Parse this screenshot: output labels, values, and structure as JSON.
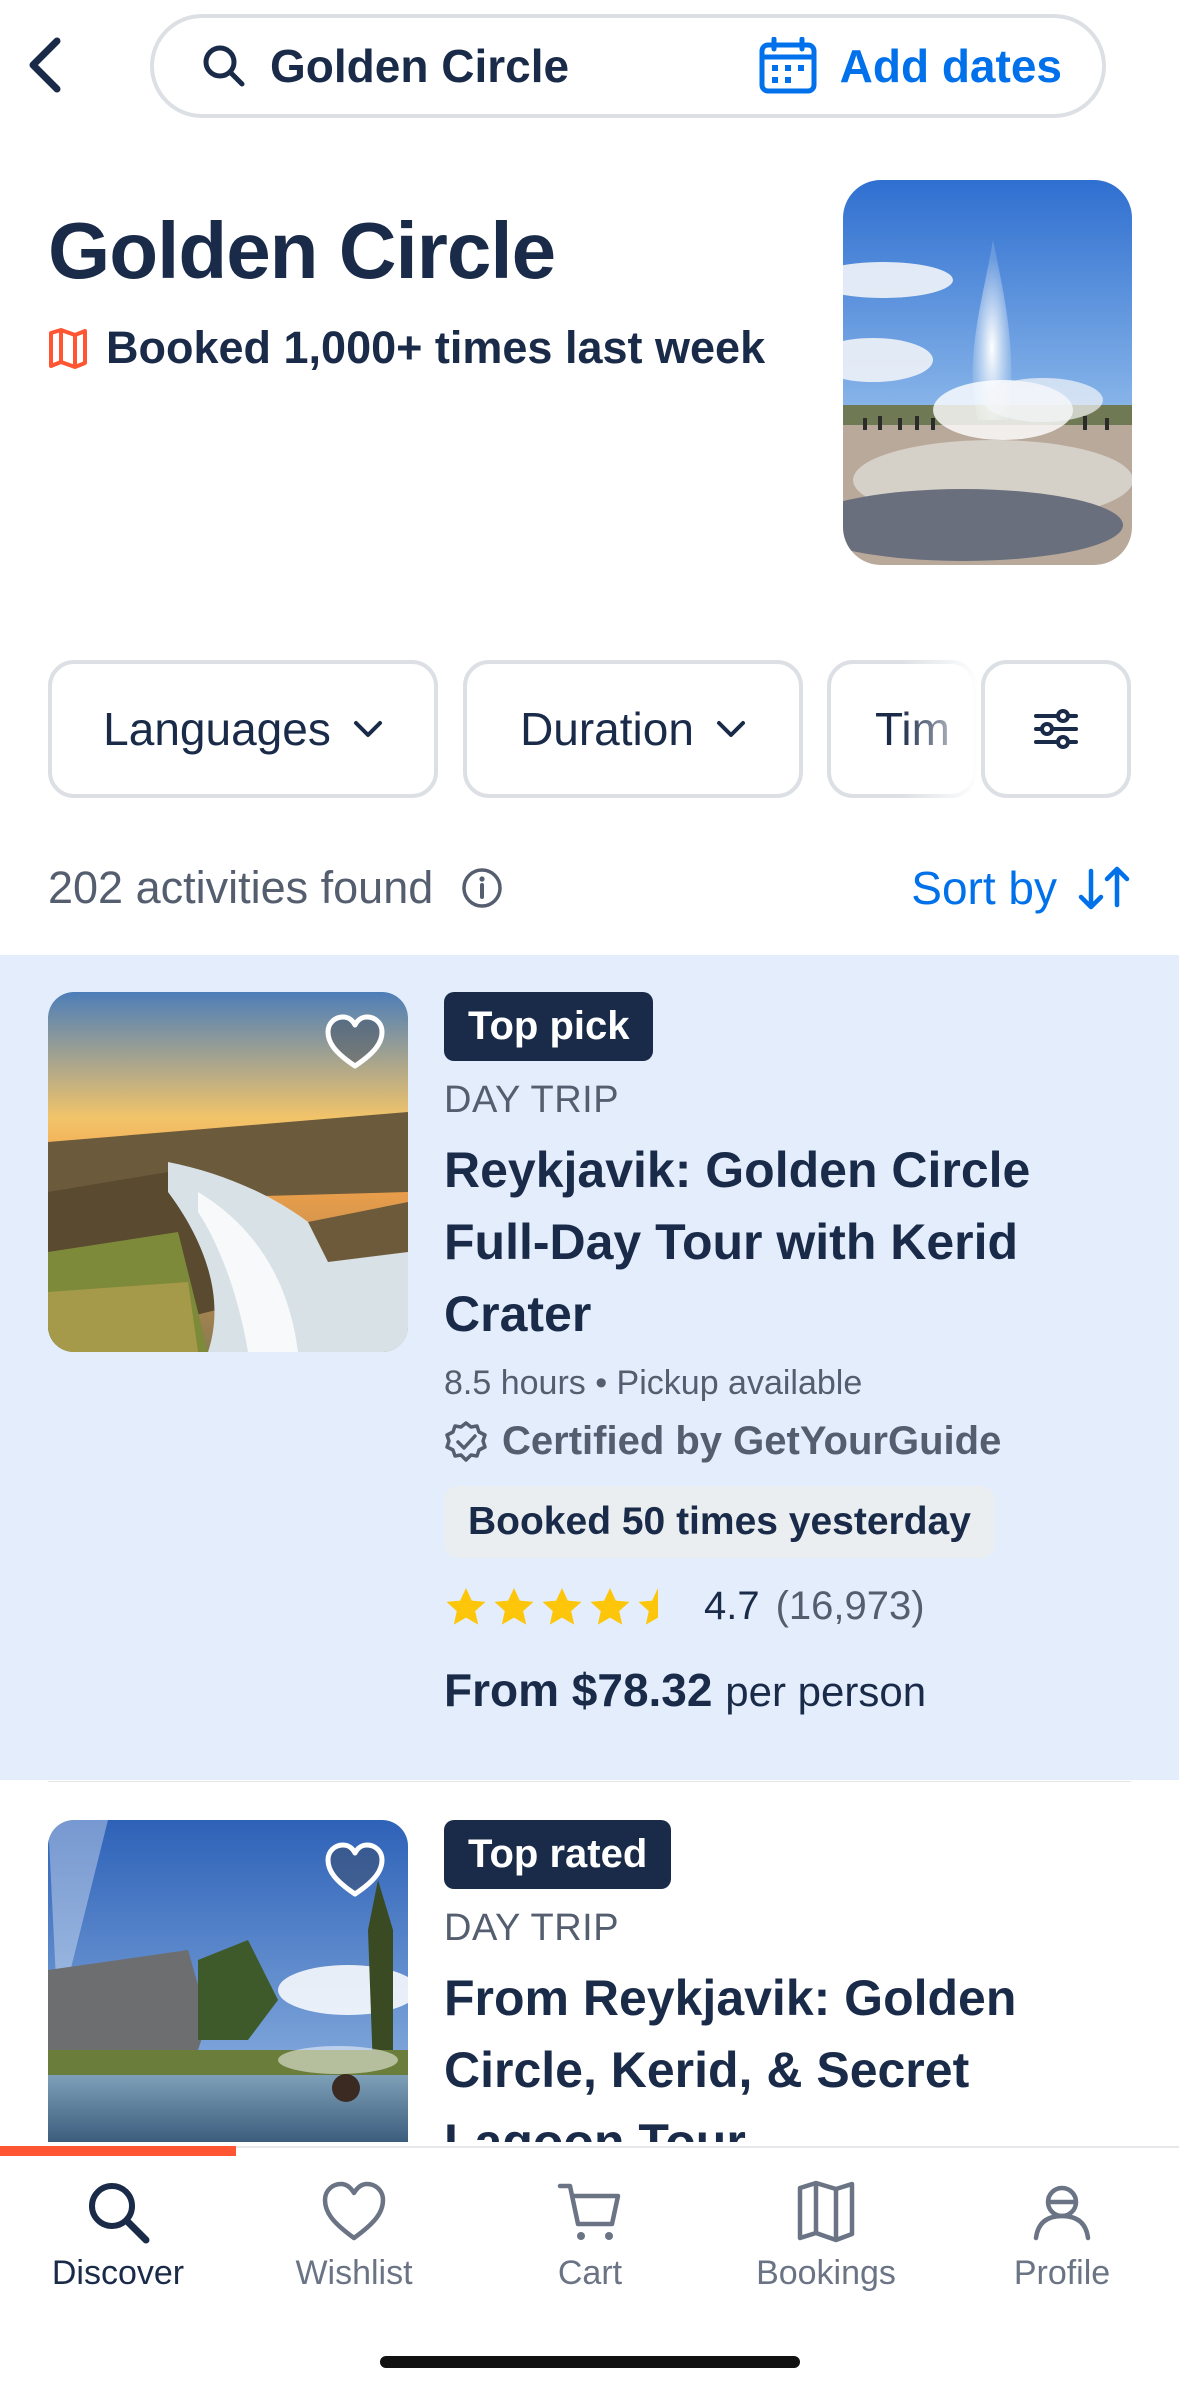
{
  "search": {
    "query": "Golden Circle",
    "dates_label": "Add dates"
  },
  "header": {
    "title": "Golden Circle",
    "booked_text": "Booked 1,000+ times last week"
  },
  "filters": {
    "languages": "Languages",
    "duration": "Duration",
    "time": "Tim"
  },
  "results": {
    "count_text": "202 activities found",
    "sort_label": "Sort by"
  },
  "cards": [
    {
      "badge": "Top pick",
      "category": "DAY TRIP",
      "title": "Reykjavik: Golden Circle Full-Day Tour with Kerid Crater",
      "meta": "8.5 hours • Pickup available",
      "certified": "Certified by GetYourGuide",
      "booked": "Booked 50 times yesterday",
      "rating": "4.7",
      "rating_count": "(16,973)",
      "rating_value": 4.7,
      "price_from": "From $78.32",
      "price_unit": "per person"
    },
    {
      "badge": "Top rated",
      "category": "DAY TRIP",
      "title": "From Reykjavik: Golden Circle, Kerid, & Secret Lagoon Tour"
    }
  ],
  "nav": {
    "items": [
      {
        "label": "Discover",
        "icon": "search-icon"
      },
      {
        "label": "Wishlist",
        "icon": "heart-icon"
      },
      {
        "label": "Cart",
        "icon": "cart-icon"
      },
      {
        "label": "Bookings",
        "icon": "bookmark-map-icon"
      },
      {
        "label": "Profile",
        "icon": "profile-icon"
      }
    ]
  },
  "colors": {
    "brand_navy": "#1a2b49",
    "accent_blue": "#0071eb",
    "accent_orange": "#ff5533",
    "star_yellow": "#fdc60a",
    "highlight_bg": "#e3edfc"
  }
}
